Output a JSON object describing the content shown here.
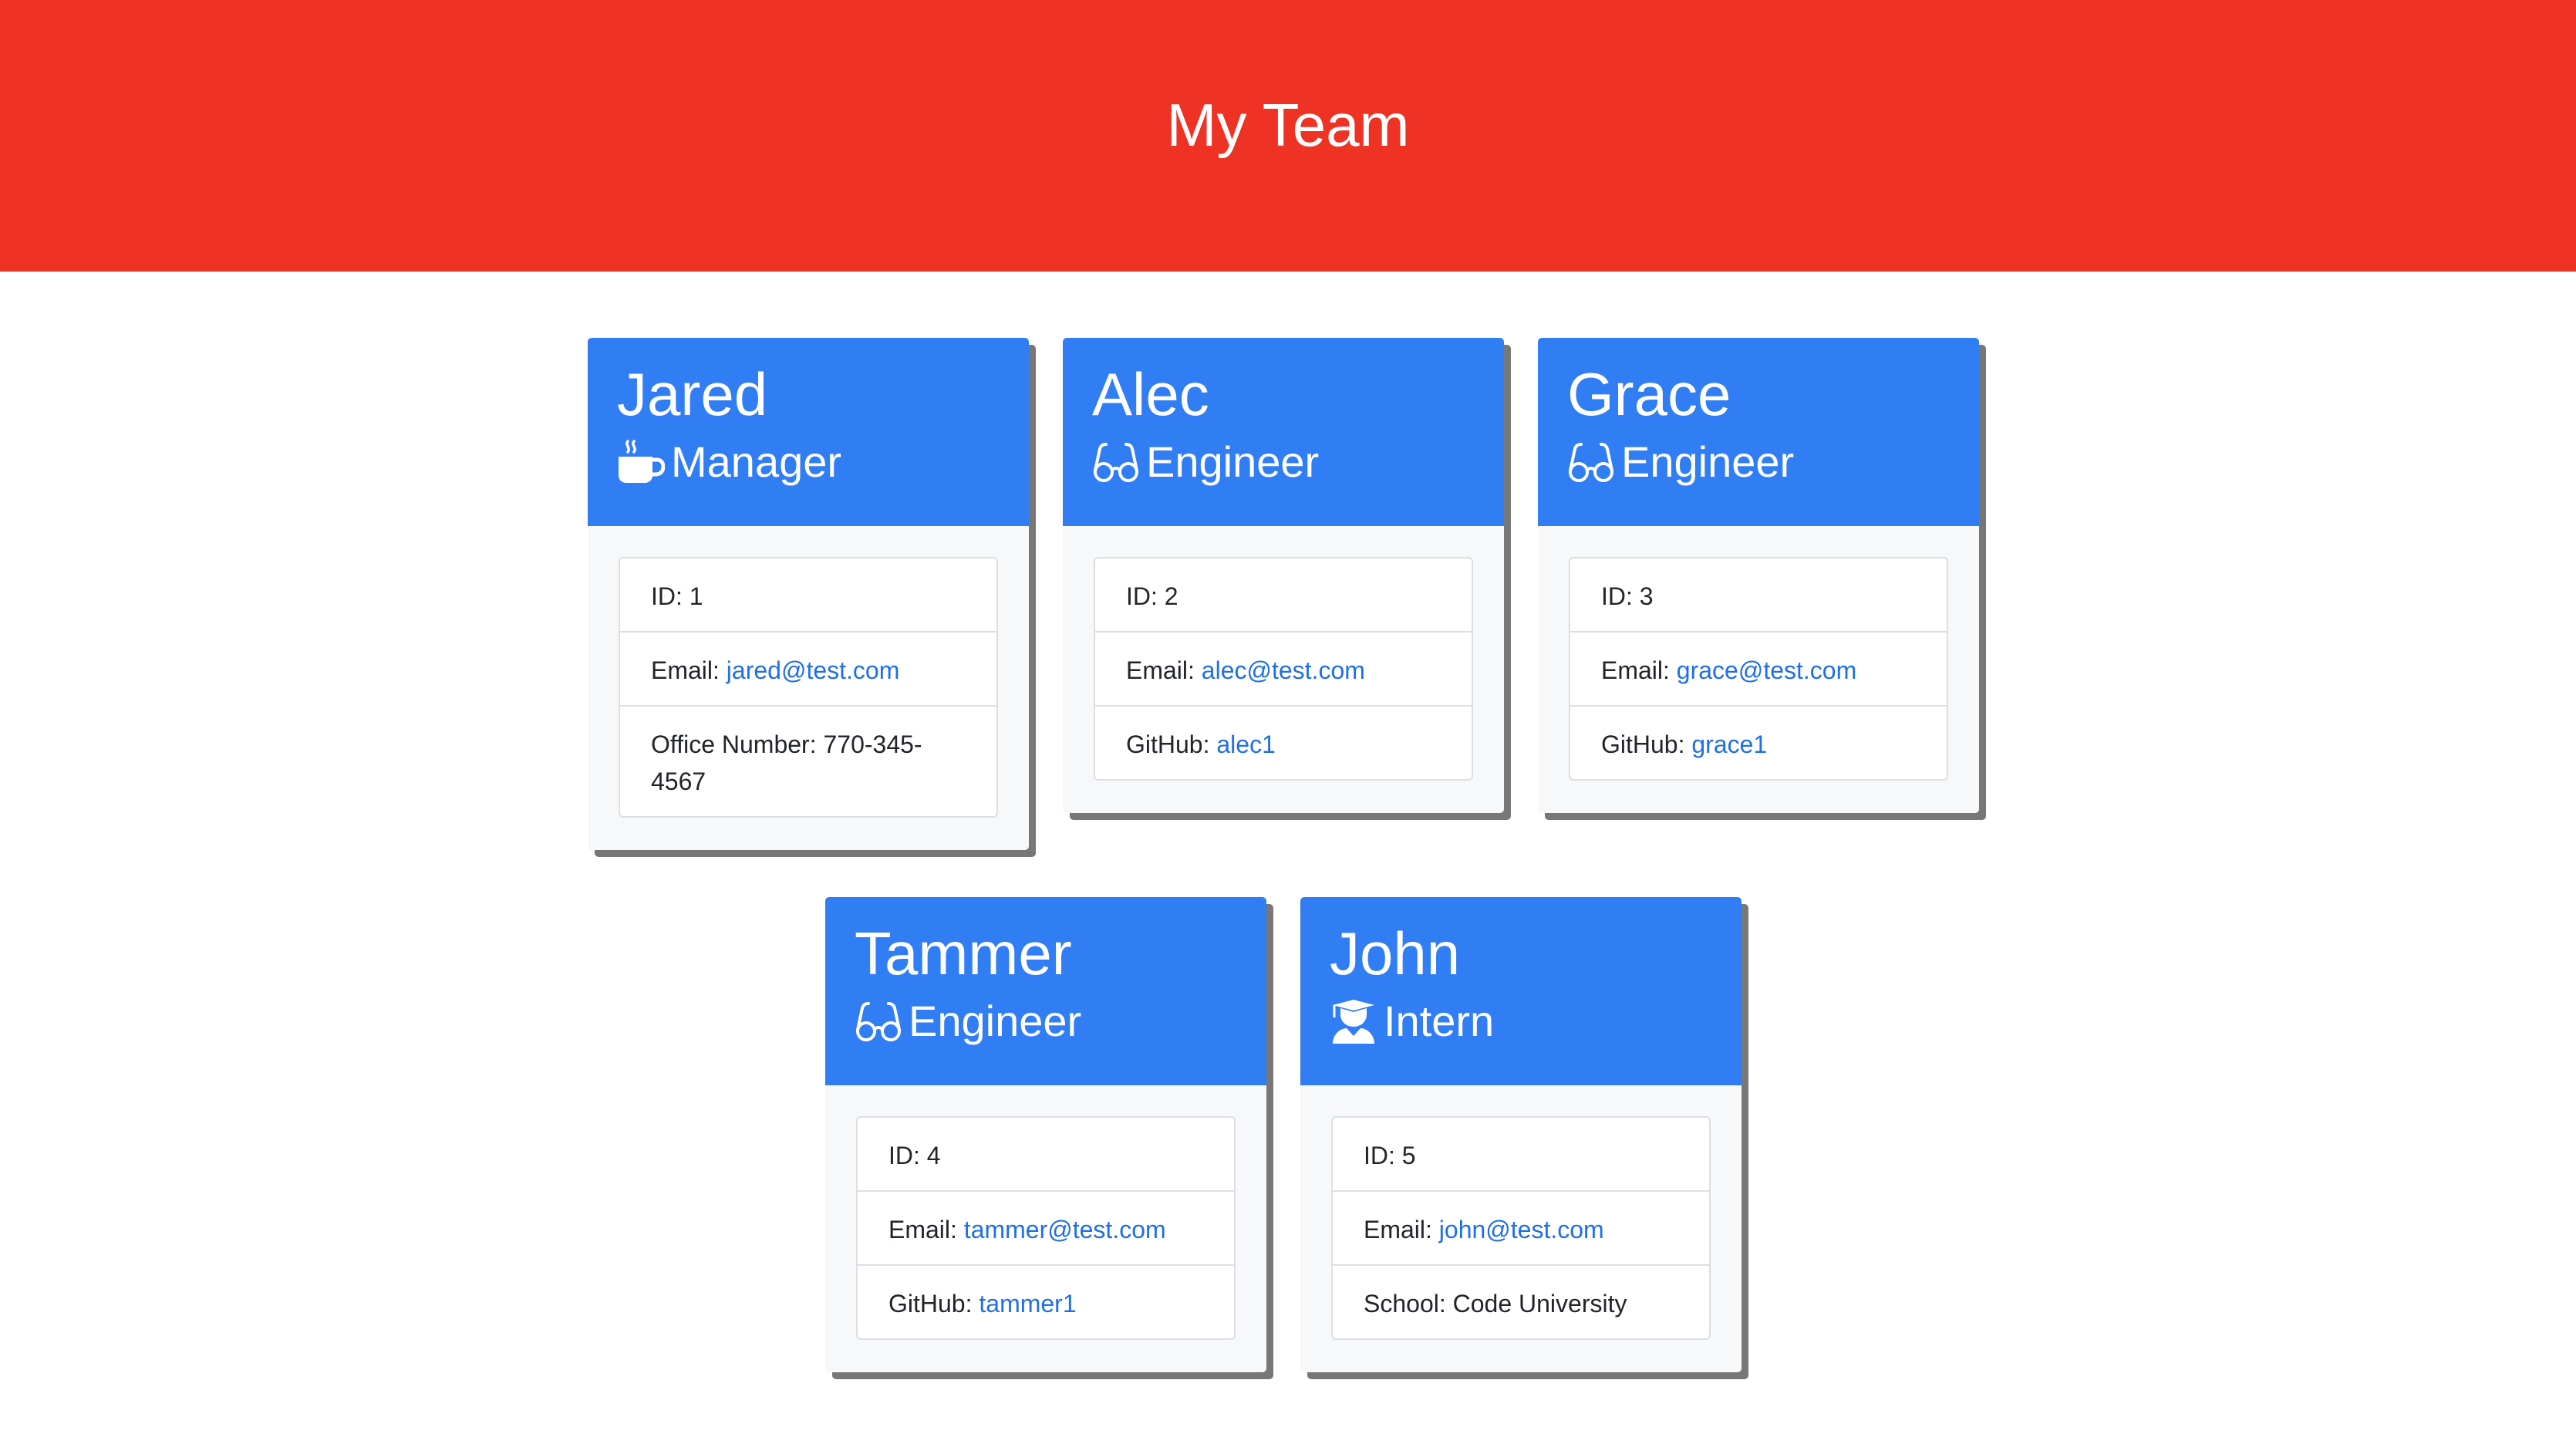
{
  "header": {
    "title": "My Team"
  },
  "colors": {
    "header_bg": "#ee3325",
    "card_header_bg": "#307df4",
    "link": "#1f6fe5"
  },
  "team": [
    {
      "name": "Jared",
      "role": "Manager",
      "role_icon": "mug-icon",
      "id_label": "ID: 1",
      "email_prefix": "Email: ",
      "email": "jared@test.com",
      "extra_prefix": "Office Number: ",
      "extra_value": "770-345-4567"
    },
    {
      "name": "Alec",
      "role": "Engineer",
      "role_icon": "glasses-icon",
      "id_label": "ID: 2",
      "email_prefix": "Email: ",
      "email": "alec@test.com",
      "extra_prefix": "GitHub: ",
      "extra_value": "alec1"
    },
    {
      "name": "Grace",
      "role": "Engineer",
      "role_icon": "glasses-icon",
      "id_label": "ID: 3",
      "email_prefix": "Email: ",
      "email": "grace@test.com",
      "extra_prefix": "GitHub: ",
      "extra_value": "grace1"
    },
    {
      "name": "Tammer",
      "role": "Engineer",
      "role_icon": "glasses-icon",
      "id_label": "ID: 4",
      "email_prefix": "Email: ",
      "email": "tammer@test.com",
      "extra_prefix": "GitHub: ",
      "extra_value": "tammer1"
    },
    {
      "name": "John",
      "role": "Intern",
      "role_icon": "graduate-icon",
      "id_label": "ID: 5",
      "email_prefix": "Email: ",
      "email": "john@test.com",
      "extra_prefix": "School: ",
      "extra_value": "Code University"
    }
  ]
}
